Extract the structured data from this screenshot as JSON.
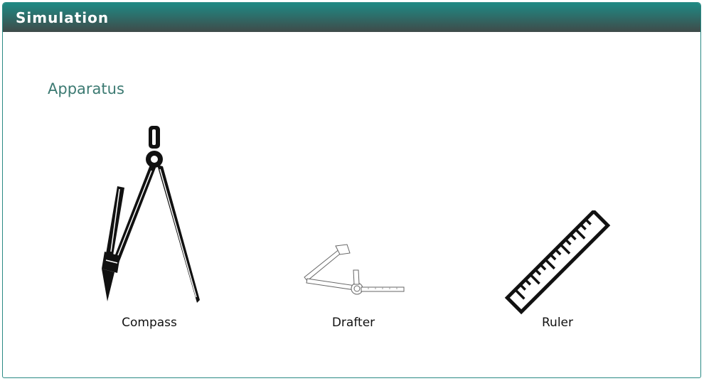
{
  "header": {
    "title": "Simulation"
  },
  "section": {
    "heading": "Apparatus"
  },
  "apparatus": [
    {
      "label": "Compass",
      "icon": "compass-icon"
    },
    {
      "label": "Drafter",
      "icon": "drafter-icon"
    },
    {
      "label": "Ruler",
      "icon": "ruler-icon"
    }
  ],
  "colors": {
    "header_top": "#1f8a84",
    "header_bottom": "#3f4a49",
    "heading": "#3c7a72",
    "border": "#2a8a84"
  }
}
